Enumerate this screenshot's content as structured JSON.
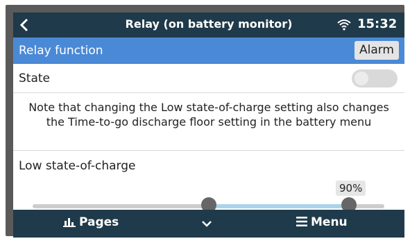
{
  "header": {
    "title": "Relay (on battery monitor)",
    "time": "15:32"
  },
  "rows": {
    "relay_function": {
      "label": "Relay function",
      "value": "Alarm"
    },
    "state": {
      "label": "State",
      "toggle_on": false
    }
  },
  "note": "Note that changing the Low state-of-charge setting also changes the Time-to-go discharge floor setting in the battery menu",
  "slider": {
    "label": "Low state-of-charge",
    "value_label": "90%",
    "range_low": 0.5,
    "range_high": 0.9
  },
  "footer": {
    "pages_label": "Pages",
    "menu_label": "Menu"
  },
  "colors": {
    "header_bg": "#1f3a4a",
    "selected_row": "#4a89d6",
    "slider_fill": "#a9d4ea"
  },
  "icons": [
    "back-icon",
    "wifi-icon",
    "pages-icon",
    "chevron-down-icon",
    "menu-icon"
  ]
}
